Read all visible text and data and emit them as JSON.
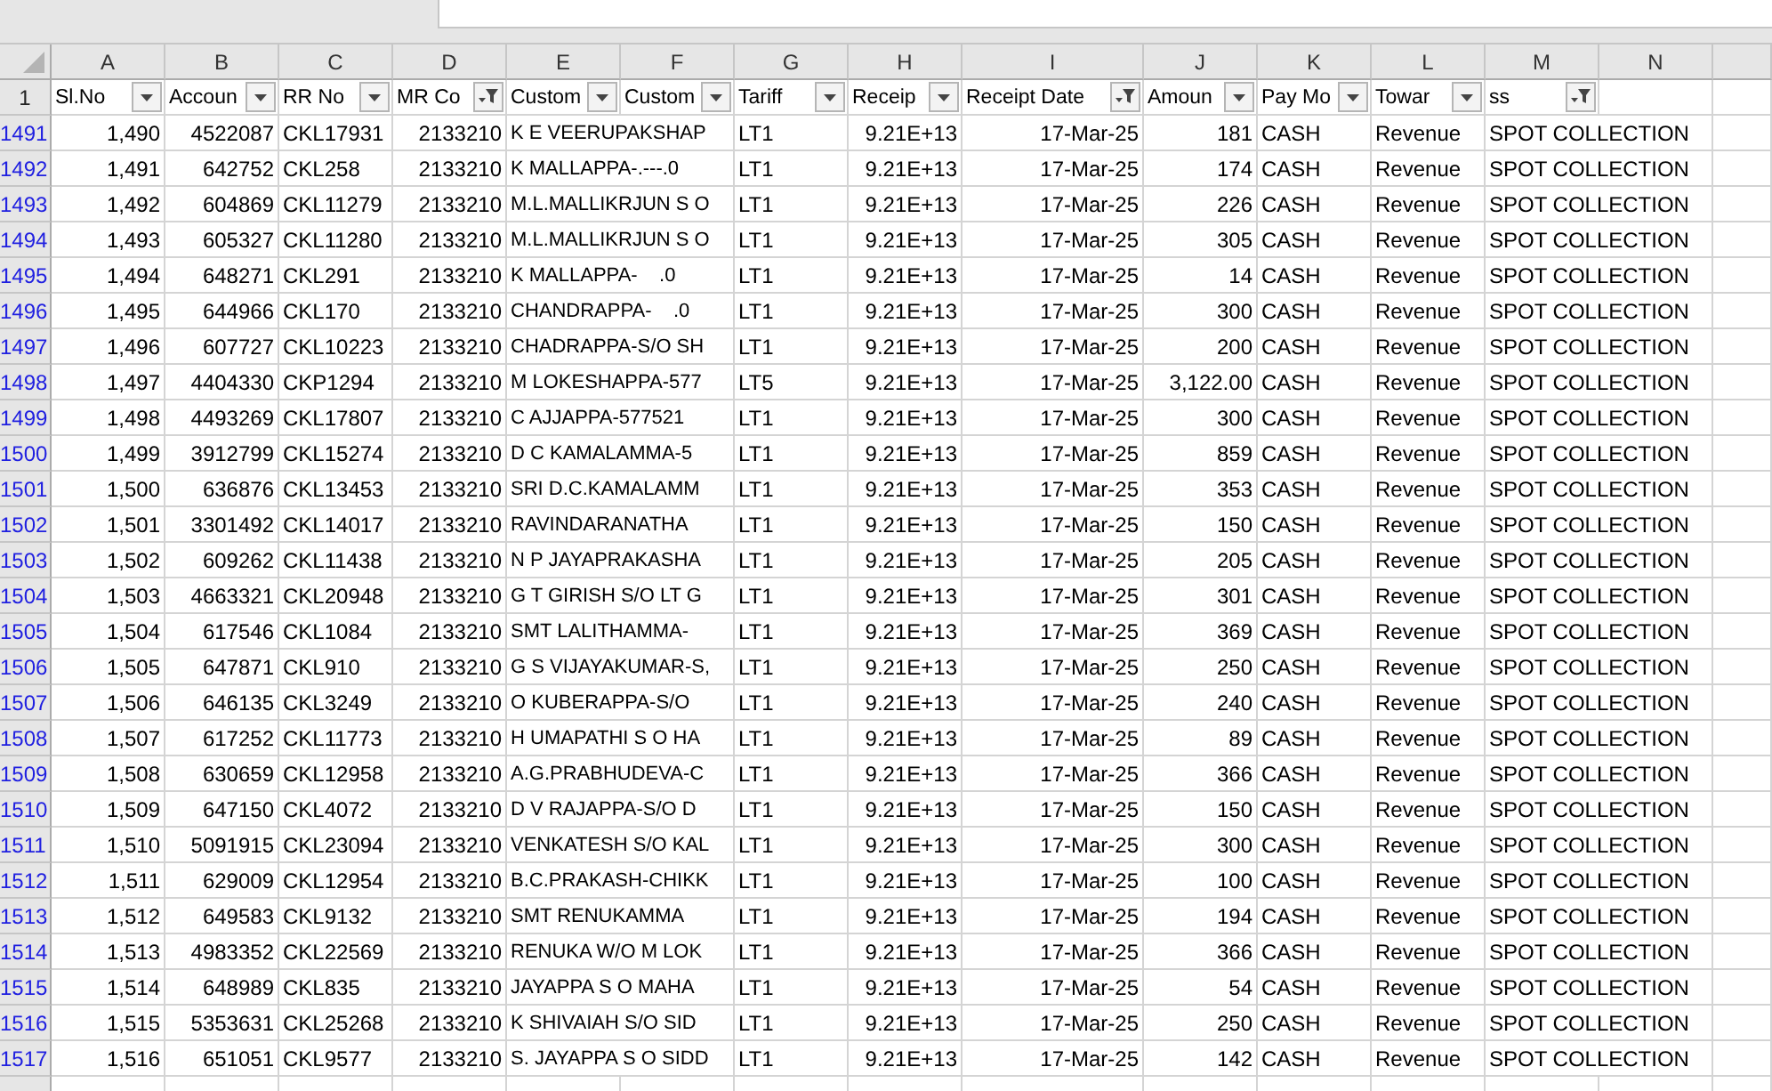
{
  "column_letters": [
    "A",
    "B",
    "C",
    "D",
    "E",
    "F",
    "G",
    "H",
    "I",
    "J",
    "K",
    "L",
    "M",
    "N"
  ],
  "header_row": {
    "number": "1",
    "fields": [
      {
        "label": "Sl.No",
        "filtered": false
      },
      {
        "label": "Accoun",
        "filtered": false
      },
      {
        "label": "RR No",
        "filtered": false
      },
      {
        "label": "MR Co",
        "filtered": true
      },
      {
        "label": "Custom",
        "filtered": false
      },
      {
        "label": "Custom",
        "filtered": false
      },
      {
        "label": "Tariff",
        "filtered": false
      },
      {
        "label": "Receip",
        "filtered": false
      },
      {
        "label": "Receipt Date",
        "filtered": true
      },
      {
        "label": "Amoun",
        "filtered": false
      },
      {
        "label": "Pay Mo",
        "filtered": false
      },
      {
        "label": "Towar",
        "filtered": false
      },
      {
        "label": "ss",
        "filtered": true
      }
    ]
  },
  "rows": [
    {
      "number": "1491",
      "cells": [
        "1,490",
        "4522087",
        "CKL17931",
        "2133210",
        "K E VEERUPAKSHAP",
        "LT1",
        "9.21E+13",
        "17-Mar-25",
        "181",
        "CASH",
        "Revenue",
        "SPOT COLLECTION"
      ]
    },
    {
      "number": "1492",
      "cells": [
        "1,491",
        "642752",
        "CKL258",
        "2133210",
        "K MALLAPPA-.---.0",
        "LT1",
        "9.21E+13",
        "17-Mar-25",
        "174",
        "CASH",
        "Revenue",
        "SPOT COLLECTION"
      ]
    },
    {
      "number": "1493",
      "cells": [
        "1,492",
        "604869",
        "CKL11279",
        "2133210",
        "M.L.MALLIKRJUN S O",
        "LT1",
        "9.21E+13",
        "17-Mar-25",
        "226",
        "CASH",
        "Revenue",
        "SPOT COLLECTION"
      ]
    },
    {
      "number": "1494",
      "cells": [
        "1,493",
        "605327",
        "CKL11280",
        "2133210",
        "M.L.MALLIKRJUN S O",
        "LT1",
        "9.21E+13",
        "17-Mar-25",
        "305",
        "CASH",
        "Revenue",
        "SPOT COLLECTION"
      ]
    },
    {
      "number": "1495",
      "cells": [
        "1,494",
        "648271",
        "CKL291",
        "2133210",
        "K MALLAPPA-    .0",
        "LT1",
        "9.21E+13",
        "17-Mar-25",
        "14",
        "CASH",
        "Revenue",
        "SPOT COLLECTION"
      ]
    },
    {
      "number": "1496",
      "cells": [
        "1,495",
        "644966",
        "CKL170",
        "2133210",
        "CHANDRAPPA-    .0",
        "LT1",
        "9.21E+13",
        "17-Mar-25",
        "300",
        "CASH",
        "Revenue",
        "SPOT COLLECTION"
      ]
    },
    {
      "number": "1497",
      "cells": [
        "1,496",
        "607727",
        "CKL10223",
        "2133210",
        "CHADRAPPA-S/O SH",
        "LT1",
        "9.21E+13",
        "17-Mar-25",
        "200",
        "CASH",
        "Revenue",
        "SPOT COLLECTION"
      ]
    },
    {
      "number": "1498",
      "cells": [
        "1,497",
        "4404330",
        "CKP1294",
        "2133210",
        "M LOKESHAPPA-577",
        "LT5",
        "9.21E+13",
        "17-Mar-25",
        "3,122.00",
        "CASH",
        "Revenue",
        "SPOT COLLECTION"
      ]
    },
    {
      "number": "1499",
      "cells": [
        "1,498",
        "4493269",
        "CKL17807",
        "2133210",
        "C AJJAPPA-577521",
        "LT1",
        "9.21E+13",
        "17-Mar-25",
        "300",
        "CASH",
        "Revenue",
        "SPOT COLLECTION"
      ]
    },
    {
      "number": "1500",
      "cells": [
        "1,499",
        "3912799",
        "CKL15274",
        "2133210",
        "D C KAMALAMMA-5",
        "LT1",
        "9.21E+13",
        "17-Mar-25",
        "859",
        "CASH",
        "Revenue",
        "SPOT COLLECTION"
      ]
    },
    {
      "number": "1501",
      "cells": [
        "1,500",
        "636876",
        "CKL13453",
        "2133210",
        "SRI D.C.KAMALAMM",
        "LT1",
        "9.21E+13",
        "17-Mar-25",
        "353",
        "CASH",
        "Revenue",
        "SPOT COLLECTION"
      ]
    },
    {
      "number": "1502",
      "cells": [
        "1,501",
        "3301492",
        "CKL14017",
        "2133210",
        "RAVINDARANATHA",
        "LT1",
        "9.21E+13",
        "17-Mar-25",
        "150",
        "CASH",
        "Revenue",
        "SPOT COLLECTION"
      ]
    },
    {
      "number": "1503",
      "cells": [
        "1,502",
        "609262",
        "CKL11438",
        "2133210",
        "N P JAYAPRAKASHA",
        "LT1",
        "9.21E+13",
        "17-Mar-25",
        "205",
        "CASH",
        "Revenue",
        "SPOT COLLECTION"
      ]
    },
    {
      "number": "1504",
      "cells": [
        "1,503",
        "4663321",
        "CKL20948",
        "2133210",
        "G T GIRISH S/O LT G",
        "LT1",
        "9.21E+13",
        "17-Mar-25",
        "301",
        "CASH",
        "Revenue",
        "SPOT COLLECTION"
      ]
    },
    {
      "number": "1505",
      "cells": [
        "1,504",
        "617546",
        "CKL1084",
        "2133210",
        "SMT LALITHAMMA-",
        "LT1",
        "9.21E+13",
        "17-Mar-25",
        "369",
        "CASH",
        "Revenue",
        "SPOT COLLECTION"
      ]
    },
    {
      "number": "1506",
      "cells": [
        "1,505",
        "647871",
        "CKL910",
        "2133210",
        "G S VIJAYAKUMAR-S,",
        "LT1",
        "9.21E+13",
        "17-Mar-25",
        "250",
        "CASH",
        "Revenue",
        "SPOT COLLECTION"
      ]
    },
    {
      "number": "1507",
      "cells": [
        "1,506",
        "646135",
        "CKL3249",
        "2133210",
        "O KUBERAPPA-S/O",
        "LT1",
        "9.21E+13",
        "17-Mar-25",
        "240",
        "CASH",
        "Revenue",
        "SPOT COLLECTION"
      ]
    },
    {
      "number": "1508",
      "cells": [
        "1,507",
        "617252",
        "CKL11773",
        "2133210",
        "H UMAPATHI S O HA",
        "LT1",
        "9.21E+13",
        "17-Mar-25",
        "89",
        "CASH",
        "Revenue",
        "SPOT COLLECTION"
      ]
    },
    {
      "number": "1509",
      "cells": [
        "1,508",
        "630659",
        "CKL12958",
        "2133210",
        "A.G.PRABHUDEVA-C",
        "LT1",
        "9.21E+13",
        "17-Mar-25",
        "366",
        "CASH",
        "Revenue",
        "SPOT COLLECTION"
      ]
    },
    {
      "number": "1510",
      "cells": [
        "1,509",
        "647150",
        "CKL4072",
        "2133210",
        "D V RAJAPPA-S/O D",
        "LT1",
        "9.21E+13",
        "17-Mar-25",
        "150",
        "CASH",
        "Revenue",
        "SPOT COLLECTION"
      ]
    },
    {
      "number": "1511",
      "cells": [
        "1,510",
        "5091915",
        "CKL23094",
        "2133210",
        "VENKATESH S/O KAL",
        "LT1",
        "9.21E+13",
        "17-Mar-25",
        "300",
        "CASH",
        "Revenue",
        "SPOT COLLECTION"
      ]
    },
    {
      "number": "1512",
      "cells": [
        "1,511",
        "629009",
        "CKL12954",
        "2133210",
        "B.C.PRAKASH-CHIKK",
        "LT1",
        "9.21E+13",
        "17-Mar-25",
        "100",
        "CASH",
        "Revenue",
        "SPOT COLLECTION"
      ]
    },
    {
      "number": "1513",
      "cells": [
        "1,512",
        "649583",
        "CKL9132",
        "2133210",
        "SMT RENUKAMMA",
        "LT1",
        "9.21E+13",
        "17-Mar-25",
        "194",
        "CASH",
        "Revenue",
        "SPOT COLLECTION"
      ]
    },
    {
      "number": "1514",
      "cells": [
        "1,513",
        "4983352",
        "CKL22569",
        "2133210",
        "RENUKA W/O M LOK",
        "LT1",
        "9.21E+13",
        "17-Mar-25",
        "366",
        "CASH",
        "Revenue",
        "SPOT COLLECTION"
      ]
    },
    {
      "number": "1515",
      "cells": [
        "1,514",
        "648989",
        "CKL835",
        "2133210",
        "JAYAPPA S O MAHA",
        "LT1",
        "9.21E+13",
        "17-Mar-25",
        "54",
        "CASH",
        "Revenue",
        "SPOT COLLECTION"
      ]
    },
    {
      "number": "1516",
      "cells": [
        "1,515",
        "5353631",
        "CKL25268",
        "2133210",
        "K SHIVAIAH S/O SID",
        "LT1",
        "9.21E+13",
        "17-Mar-25",
        "250",
        "CASH",
        "Revenue",
        "SPOT COLLECTION"
      ]
    },
    {
      "number": "1517",
      "cells": [
        "1,516",
        "651051",
        "CKL9577",
        "2133210",
        "S. JAYAPPA S O SIDD",
        "LT1",
        "9.21E+13",
        "17-Mar-25",
        "142",
        "CASH",
        "Revenue",
        "SPOT COLLECTION"
      ]
    }
  ]
}
